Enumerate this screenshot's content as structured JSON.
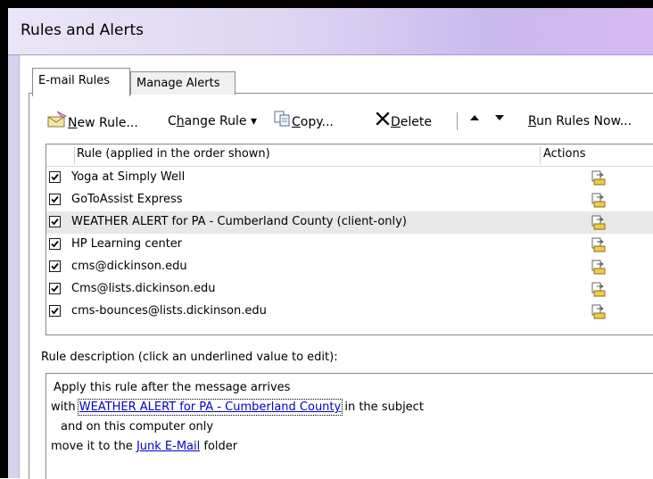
{
  "window": {
    "title": "Rules and Alerts"
  },
  "tabs": [
    {
      "label": "E-mail Rules",
      "active": true
    },
    {
      "label": "Manage Alerts",
      "active": false
    }
  ],
  "toolbar": {
    "new_rule": {
      "pre": "",
      "u": "N",
      "post": "ew Rule..."
    },
    "change_rule": {
      "pre": "C",
      "u": "h",
      "post": "ange Rule ▾"
    },
    "copy": {
      "pre": "",
      "u": "C",
      "post": "opy..."
    },
    "delete": {
      "pre": "",
      "u": "D",
      "post": "elete"
    },
    "run_rules": {
      "pre": "",
      "u": "R",
      "post": "un Rules Now..."
    }
  },
  "rules_list": {
    "columns": [
      "Rule (applied in the order shown)",
      "Actions"
    ],
    "rows": [
      {
        "name": "Yoga at Simply Well",
        "checked": true,
        "selected": false
      },
      {
        "name": "GoToAssist Express",
        "checked": true,
        "selected": false
      },
      {
        "name": "WEATHER ALERT for PA - Cumberland County  (client-only)",
        "checked": true,
        "selected": true
      },
      {
        "name": "HP Learning center",
        "checked": true,
        "selected": false
      },
      {
        "name": "cms@dickinson.edu",
        "checked": true,
        "selected": false
      },
      {
        "name": "Cms@lists.dickinson.edu",
        "checked": true,
        "selected": false
      },
      {
        "name": "cms-bounces@lists.dickinson.edu",
        "checked": true,
        "selected": false
      }
    ],
    "action_icon": "move-to-folder-icon"
  },
  "description": {
    "label": "Rule description (click an underlined value to edit):",
    "line1": "Apply this rule after the message arrives",
    "line2_pre": "with ",
    "line2_link": "WEATHER ALERT for PA - Cumberland County",
    "line2_post": " in the subject",
    "line3": "and on this computer only",
    "line4_pre": "move it to the ",
    "line4_link": "Junk E-Mail",
    "line4_post": " folder"
  },
  "colors": {
    "link": "#0000c8",
    "selected_row": "#e8e8e8",
    "title_gradient_end": "#d7b8f2"
  }
}
